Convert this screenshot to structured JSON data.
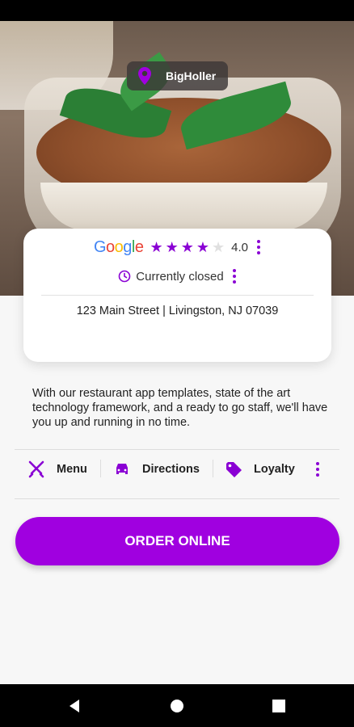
{
  "location": {
    "name": "BigHoller",
    "icon": "location-pin-icon"
  },
  "rating": {
    "provider": "Google",
    "value": "4.0",
    "stars_filled": 4,
    "stars_total": 5
  },
  "status": {
    "text": "Currently closed",
    "icon": "clock-icon"
  },
  "address": "123 Main Street | Livingston, NJ  07039",
  "description": "With our restaurant app templates, state of the art technology framework, and a ready to go staff, we'll have you up and running in no time.",
  "actions": [
    {
      "label": "Menu",
      "icon": "fork-knife-icon"
    },
    {
      "label": "Directions",
      "icon": "car-icon"
    },
    {
      "label": "Loyalty",
      "icon": "tag-icon"
    }
  ],
  "order_button": "ORDER ONLINE",
  "colors": {
    "accent": "#8a00d4",
    "button": "#a000e0"
  }
}
